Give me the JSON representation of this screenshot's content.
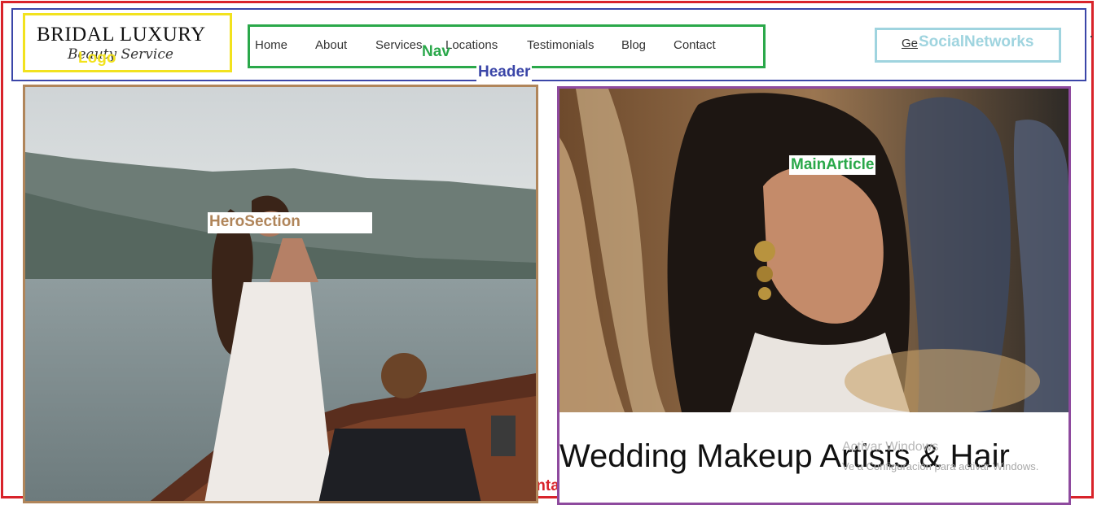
{
  "annotations": {
    "app": "AppContainer",
    "header": "Header",
    "logo": "Logo",
    "nav": "Nav",
    "social": "SocialNetworks",
    "hero": "HeroSection",
    "article": "MainArticle"
  },
  "logo": {
    "title": "BRIDAL LUXURY",
    "script": "Beauty Service"
  },
  "nav": {
    "items": [
      {
        "label": "Home"
      },
      {
        "label": "About"
      },
      {
        "label": "Services"
      },
      {
        "label": "Locations"
      },
      {
        "label": "Testimonials"
      },
      {
        "label": "Blog"
      },
      {
        "label": "Contact"
      }
    ]
  },
  "social": {
    "get_label": "Ge"
  },
  "article": {
    "title": "Wedding Makeup Artists & Hair"
  },
  "os_watermark": {
    "line1": "Activar Windows",
    "line2": "Ve a Configuración para activar Windows."
  },
  "colors": {
    "app_border": "#d8232a",
    "header_border": "#3b46a8",
    "logo_border": "#f2e21e",
    "nav_border": "#2aa84a",
    "social_border": "#9fd4df",
    "hero_border": "#b0855a",
    "article_border": "#8e4a9e"
  }
}
